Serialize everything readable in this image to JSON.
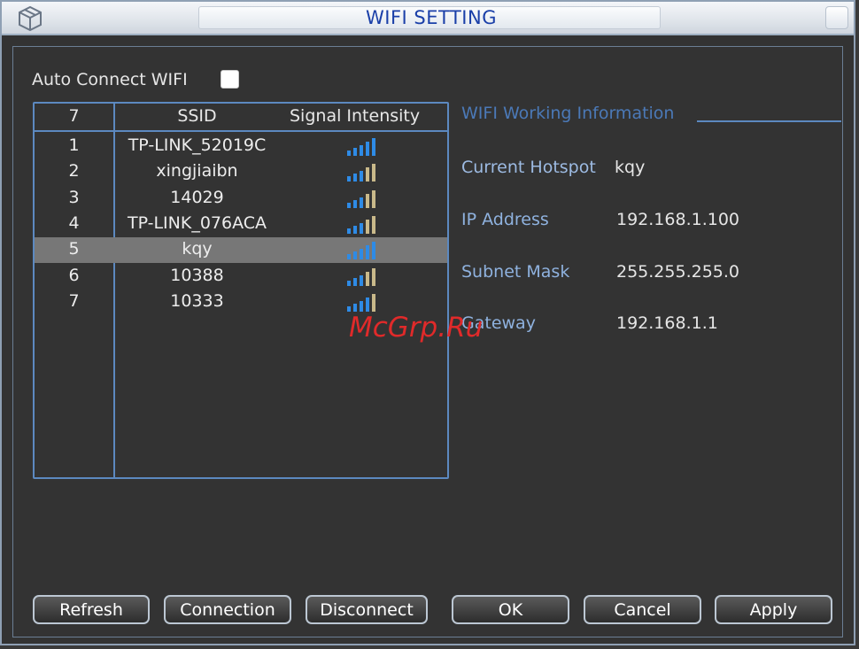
{
  "window": {
    "title": "WIFI SETTING"
  },
  "auto_connect": {
    "label": "Auto Connect WIFI",
    "checked": false
  },
  "list": {
    "header": {
      "count": "7",
      "ssid": "SSID",
      "signal": "Signal Intensity"
    },
    "rows": [
      {
        "num": "1",
        "ssid": "TP-LINK_52019C",
        "signal": 5
      },
      {
        "num": "2",
        "ssid": "xingjiaibn",
        "signal": 3
      },
      {
        "num": "3",
        "ssid": "14029",
        "signal": 3
      },
      {
        "num": "4",
        "ssid": "TP-LINK_076ACA",
        "signal": 3
      },
      {
        "num": "5",
        "ssid": "kqy",
        "signal": 5,
        "selected": true
      },
      {
        "num": "6",
        "ssid": "10388",
        "signal": 3
      },
      {
        "num": "7",
        "ssid": "10333",
        "signal": 4
      }
    ]
  },
  "info": {
    "title": "WIFI Working Information",
    "current_hotspot": {
      "label": "Current Hotspot",
      "value": "kqy"
    },
    "ip_address": {
      "label": "IP Address",
      "value": "192.168.1.100"
    },
    "subnet_mask": {
      "label": "Subnet Mask",
      "value": "255.255.255.0"
    },
    "gateway": {
      "label": "Gateway",
      "value": "192.168.1.1"
    }
  },
  "buttons": {
    "refresh": "Refresh",
    "connection": "Connection",
    "disconnect": "Disconnect",
    "ok": "OK",
    "cancel": "Cancel",
    "apply": "Apply"
  },
  "watermark": "McGrp.Ru",
  "colors": {
    "signal_active": "#2e8be6",
    "signal_inactive": "#c9b98a",
    "accent": "#5c89c0",
    "title_text": "#1a3fa8"
  }
}
